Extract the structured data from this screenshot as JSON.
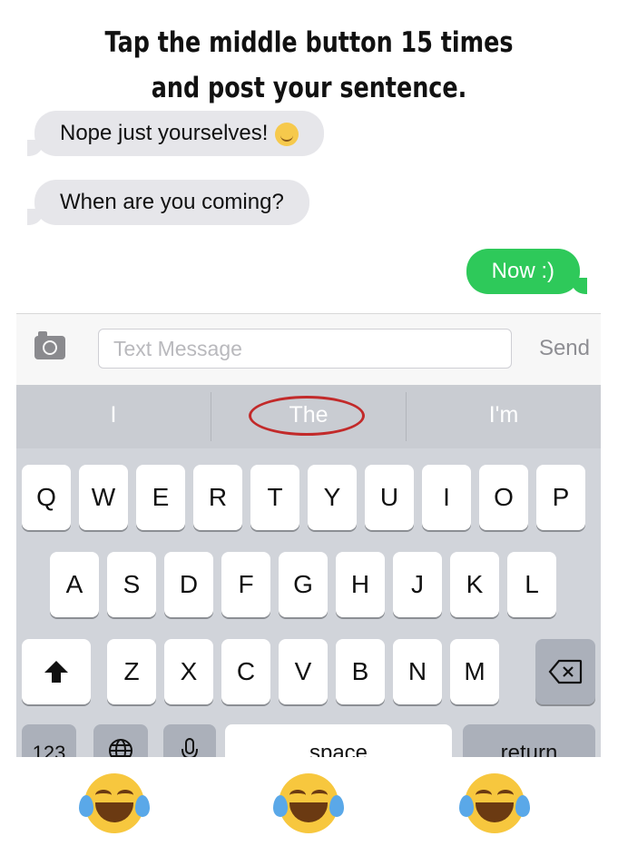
{
  "caption": {
    "line1": "Tap the middle button 15 times",
    "line2": "and post your sentence."
  },
  "messages": {
    "in1": "Nope just yourselves!",
    "in2": "When are you coming?",
    "out1": "Now :)"
  },
  "input": {
    "placeholder": "Text Message",
    "send_label": "Send"
  },
  "predictions": [
    "I",
    "The",
    "I'm"
  ],
  "keyboard": {
    "row1": [
      "Q",
      "W",
      "E",
      "R",
      "T",
      "Y",
      "U",
      "I",
      "O",
      "P"
    ],
    "row2": [
      "A",
      "S",
      "D",
      "F",
      "G",
      "H",
      "J",
      "K",
      "L"
    ],
    "row3": [
      "Z",
      "X",
      "C",
      "V",
      "B",
      "N",
      "M"
    ],
    "numbers_label": "123",
    "space_label": "space",
    "return_label": "return"
  },
  "colors": {
    "sent_bubble": "#2ec95a",
    "received_bubble": "#e6e6ea",
    "highlight_circle": "#c22a2a"
  }
}
